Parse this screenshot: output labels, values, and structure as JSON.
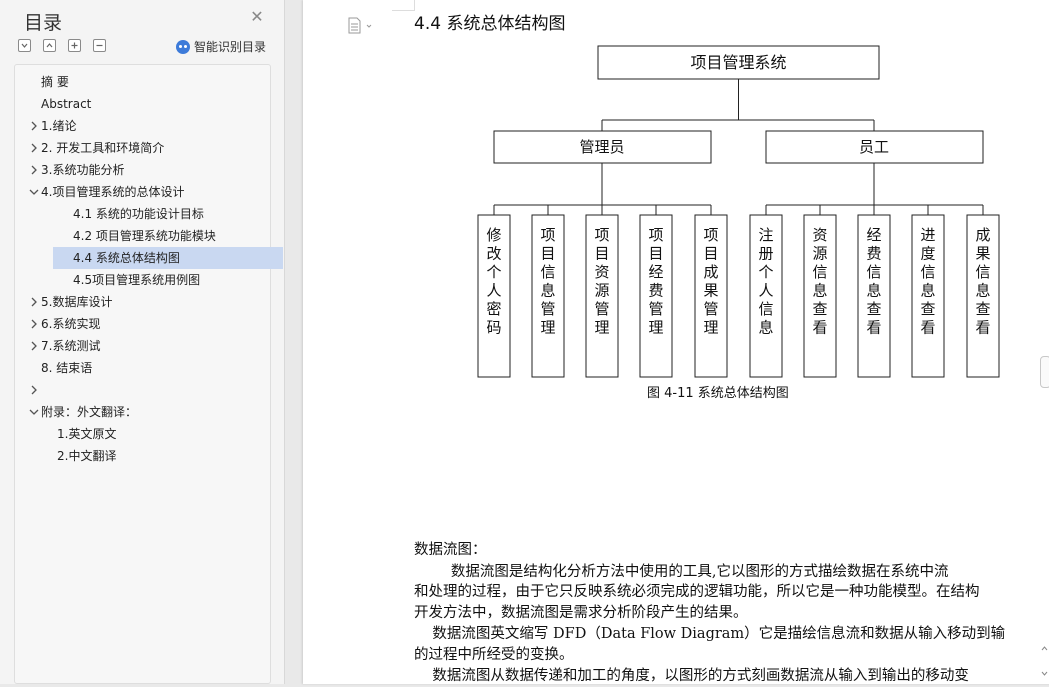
{
  "sidebar": {
    "title": "目录",
    "smart_toc_label": "智能识别目录",
    "items": [
      {
        "label": "摘  要",
        "level": 0,
        "chevron": "none"
      },
      {
        "label": "Abstract",
        "level": 0,
        "chevron": "none"
      },
      {
        "label": "1.绪论",
        "level": 0,
        "chevron": "right"
      },
      {
        "label": "2. 开发工具和环境简介",
        "level": 0,
        "chevron": "right"
      },
      {
        "label": "3.系统功能分析",
        "level": 0,
        "chevron": "right"
      },
      {
        "label": "4.项目管理系统的总体设计",
        "level": 0,
        "chevron": "down"
      },
      {
        "label": "4.1  系统的功能设计目标",
        "level": 1,
        "chevron": "none"
      },
      {
        "label": "4.2  项目管理系统功能模块",
        "level": 1,
        "chevron": "none"
      },
      {
        "label": "4.4  系统总体结构图",
        "level": 1,
        "chevron": "none",
        "selected": true
      },
      {
        "label": "4.5项目管理系统用例图",
        "level": 1,
        "chevron": "none"
      },
      {
        "label": "5.数据库设计",
        "level": 0,
        "chevron": "right"
      },
      {
        "label": "6.系统实现",
        "level": 0,
        "chevron": "right"
      },
      {
        "label": "7.系统测试",
        "level": 0,
        "chevron": "right"
      },
      {
        "label": "8. 结束语",
        "level": 0,
        "chevron": "none"
      },
      {
        "label": "",
        "level": 0,
        "chevron": "right"
      },
      {
        "label": "附录：外文翻译：",
        "level": 0,
        "chevron": "down"
      },
      {
        "label": "1.英文原文",
        "level": 2,
        "chevron": "none"
      },
      {
        "label": "2.中文翻译",
        "level": 2,
        "chevron": "none"
      }
    ]
  },
  "document": {
    "heading": "4.4  系统总体结构图",
    "diagram": {
      "root": "项目管理系统",
      "groups": [
        {
          "label": "管理员",
          "children": [
            "修改个人密码",
            "项目信息管理",
            "项目资源管理",
            "项目经费管理",
            "项目成果管理"
          ]
        },
        {
          "label": "员工",
          "children": [
            "注册个人信息",
            "资源信息查看",
            "经费信息查看",
            "进度信息查看",
            "成果信息查看"
          ]
        }
      ]
    },
    "caption": "图 4-11 系统总体结构图",
    "paragraphs": [
      "数据流图：",
      "        数据流图是结构化分析方法中使用的工具,它以图形的方式描绘数据在系统中流",
      "和处理的过程，由于它只反映系统必须完成的逻辑功能，所以它是一种功能模型。在结构",
      "开发方法中，数据流图是需求分析阶段产生的结果。",
      "    数据流图英文缩写 DFD（Data Flow Diagram）它是描绘信息流和数据从输入移动到输",
      "的过程中所经受的变换。",
      "    数据流图从数据传递和加工的角度，以图形的方式刻画数据流从输入到输出的移动变"
    ]
  },
  "icons": {
    "close": "close-icon",
    "collapse_all": "collapse-all-icon",
    "expand_all": "expand-all-icon",
    "add": "add-icon",
    "remove": "remove-icon",
    "smart": "smart-robot-icon",
    "page_options": "document-options-icon"
  },
  "colors": {
    "selection": "#c9d8f1",
    "accent": "#3d7bd9"
  }
}
